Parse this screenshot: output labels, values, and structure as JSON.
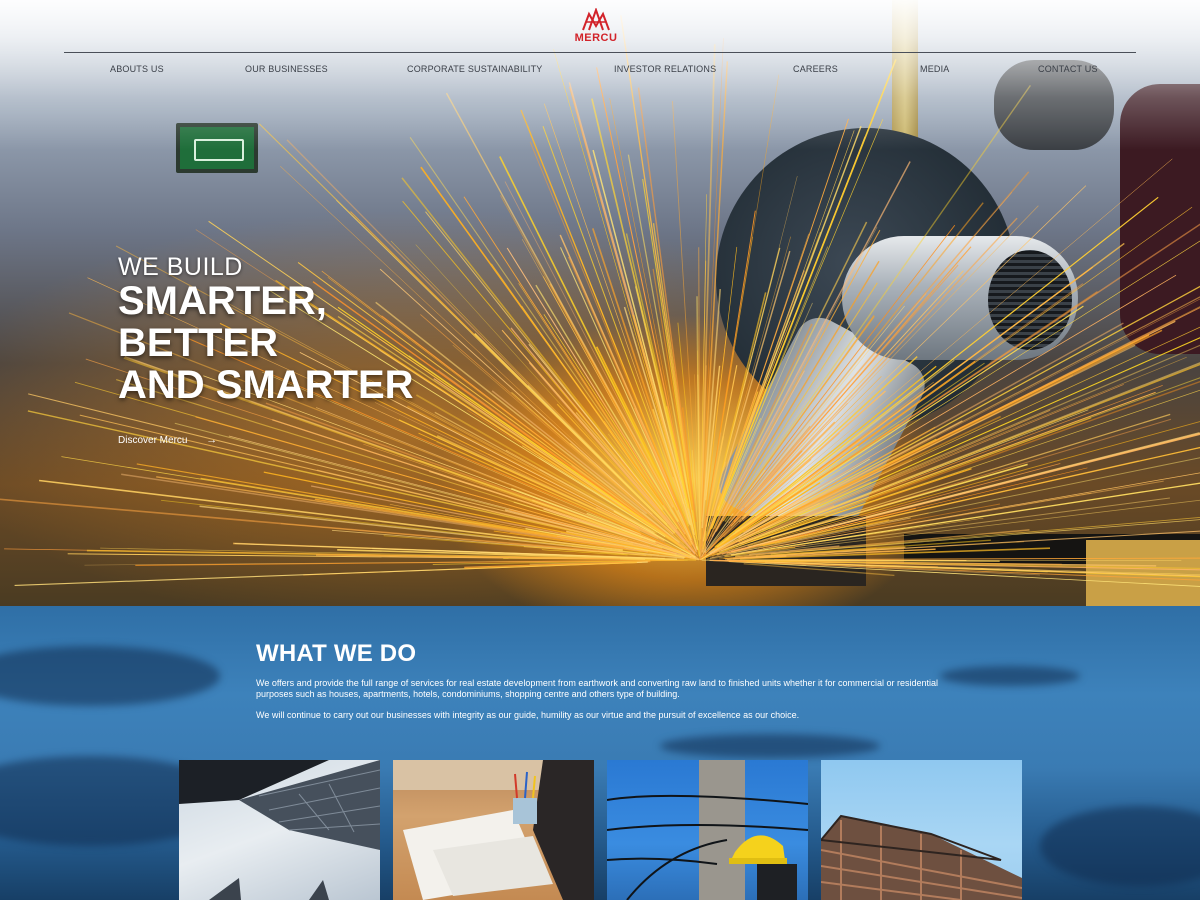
{
  "brand": {
    "name": "MERCU",
    "color": "#d2232a"
  },
  "nav": {
    "items": [
      {
        "label": "ABOUTS US"
      },
      {
        "label": "OUR BUSINESSES"
      },
      {
        "label": "CORPORATE SUSTAINABILITY"
      },
      {
        "label": "INVESTOR RELATIONS"
      },
      {
        "label": "CAREERS"
      },
      {
        "label": "MEDIA"
      },
      {
        "label": "CONTACT US"
      }
    ]
  },
  "hero": {
    "pre_heading": "WE BUILD",
    "heading_lines": [
      "SMARTER,",
      "BETTER",
      "AND SMARTER"
    ],
    "cta_label": "Discover Mercu",
    "cta_icon": "arrow-right-icon"
  },
  "what_we_do": {
    "title": "WHAT WE DO",
    "paragraph_1": "We offers and provide the full range of services for real estate development from earthwork and converting raw land to finished units whether it for commercial or residential purposes such as houses, apartments, hotels, condominiums, shopping centre and others type of building.",
    "paragraph_2": "We will continue to carry out our businesses with integrity as our guide, humility as our virtue and the pursuit of excellence as our choice.",
    "tiles": [
      {
        "image": "skyscraper-photo"
      },
      {
        "image": "blueprints-desk-photo"
      },
      {
        "image": "electrician-pole-photo"
      },
      {
        "image": "building-construction-photo"
      }
    ]
  },
  "colors": {
    "accent": "#d2232a",
    "section_blue": "#3a7bb3",
    "spark_orange": "#ffb030"
  }
}
